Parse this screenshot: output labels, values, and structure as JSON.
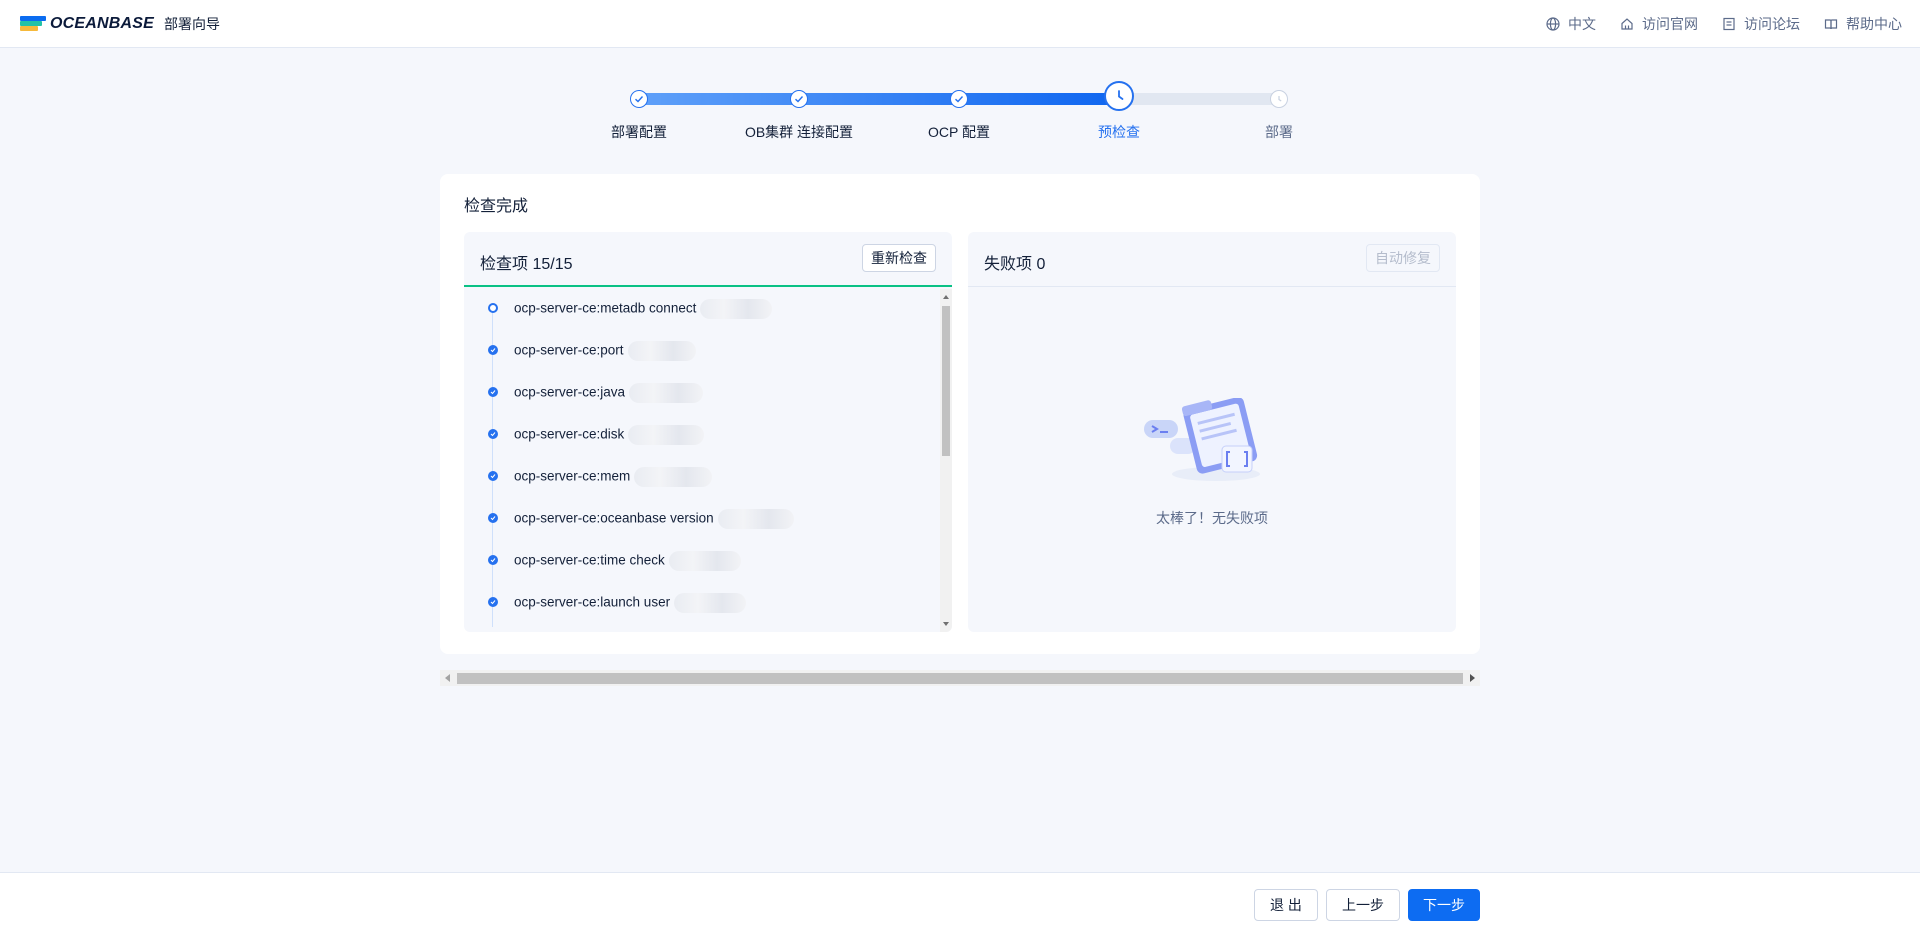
{
  "header": {
    "logo_text": "OCEANBASE",
    "subtitle": "部署向导",
    "nav": [
      {
        "label": "中文",
        "icon": "globe-icon"
      },
      {
        "label": "访问官网",
        "icon": "home-icon"
      },
      {
        "label": "访问论坛",
        "icon": "forum-icon"
      },
      {
        "label": "帮助中心",
        "icon": "book-icon"
      }
    ]
  },
  "steps": [
    {
      "label": "部署配置",
      "status": "done"
    },
    {
      "label": "OB集群 连接配置",
      "status": "done"
    },
    {
      "label": "OCP 配置",
      "status": "done"
    },
    {
      "label": "预检查",
      "status": "current"
    },
    {
      "label": "部署",
      "status": "pending"
    }
  ],
  "card": {
    "title": "检查完成",
    "checks": {
      "title": "检查项 15/15",
      "recheck_label": "重新检查",
      "items": [
        "ocp-server-ce:metadb connect",
        "ocp-server-ce:port",
        "ocp-server-ce:java",
        "ocp-server-ce:disk",
        "ocp-server-ce:mem",
        "ocp-server-ce:oceanbase version",
        "ocp-server-ce:time check",
        "ocp-server-ce:launch user"
      ]
    },
    "failures": {
      "title": "失败项 0",
      "autofix_label": "自动修复",
      "empty_text": "太棒了！无失败项"
    }
  },
  "footer": {
    "exit_label": "退 出",
    "prev_label": "上一步",
    "next_label": "下一步"
  },
  "colors": {
    "primary": "#0d6cf2",
    "success_underline": "#0ac185",
    "background": "#f5f7fc"
  }
}
